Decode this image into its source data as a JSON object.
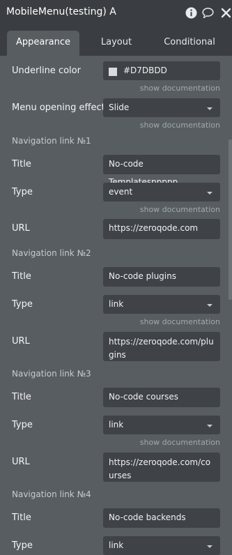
{
  "window": {
    "title": "MobileMenu(testing) A",
    "icons": [
      "info-icon",
      "comment-icon",
      "close-icon"
    ]
  },
  "tabs": [
    {
      "label": "Appearance",
      "active": true
    },
    {
      "label": "Layout",
      "active": false
    },
    {
      "label": "Conditional",
      "active": false
    }
  ],
  "appearance": {
    "underline_color": {
      "label": "Underline color",
      "value": "#D7DBDD",
      "swatch": "#D7DBDD",
      "doc": "show documentation"
    },
    "menu_effect": {
      "label": "Menu opening effect",
      "value": "Slide",
      "doc": "show documentation"
    }
  },
  "nav": [
    {
      "heading": "Navigation link №1",
      "title_label": "Title",
      "title": "No-code Templatesppppp",
      "type_label": "Type",
      "type": "event",
      "doc": "show documentation",
      "url_label": "URL",
      "url": "https://zeroqode.com"
    },
    {
      "heading": "Navigation link №2",
      "title_label": "Title",
      "title": "No-code plugins",
      "type_label": "Type",
      "type": "link",
      "doc": "show documentation",
      "url_label": "URL",
      "url": "https://zeroqode.com/plugins"
    },
    {
      "heading": "Navigation link №3",
      "title_label": "Title",
      "title": "No-code courses",
      "type_label": "Type",
      "type": "link",
      "doc": "show documentation",
      "url_label": "URL",
      "url": "https://zeroqode.com/courses"
    },
    {
      "heading": "Navigation link №4",
      "title_label": "Title",
      "title": "No-code backends",
      "type_label": "Type",
      "type": "link"
    }
  ]
}
